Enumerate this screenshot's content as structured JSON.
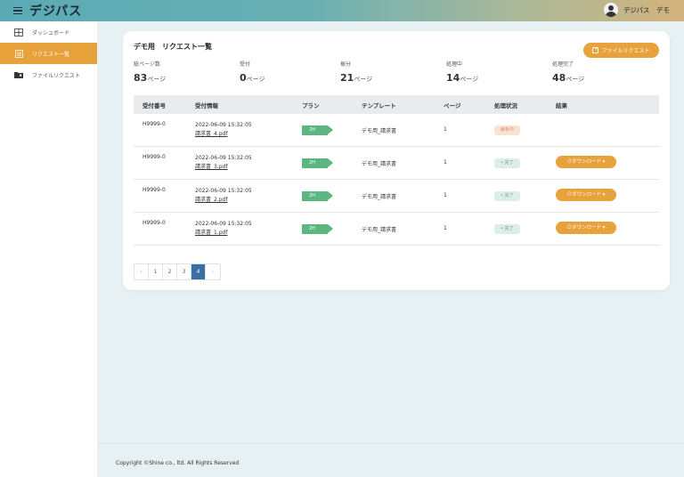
{
  "app": {
    "brand": "デジパス",
    "user": "デジパス　デモ"
  },
  "sidebar": {
    "items": [
      {
        "label": "ダッシュボード",
        "icon": "grid-icon"
      },
      {
        "label": "リクエスト一覧",
        "icon": "list-icon"
      },
      {
        "label": "ファイルリクエスト",
        "icon": "folder-icon"
      }
    ]
  },
  "card": {
    "title": "デモ用　リクエスト一覧",
    "file_request_button": "ファイルリクエスト"
  },
  "stats": [
    {
      "label": "総ページ数",
      "value": "83",
      "unit": "ページ"
    },
    {
      "label": "受付",
      "value": "0",
      "unit": "ページ"
    },
    {
      "label": "振分",
      "value": "21",
      "unit": "ページ"
    },
    {
      "label": "処理中",
      "value": "14",
      "unit": "ページ"
    },
    {
      "label": "処理完了",
      "value": "48",
      "unit": "ページ"
    }
  ],
  "table": {
    "headers": [
      "受付番号",
      "受付情報",
      "プラン",
      "テンプレート",
      "ページ",
      "処理状況",
      "結果"
    ],
    "rows": [
      {
        "id": "H9999-0",
        "date": "2022-06-09 15:32:05",
        "file": "請求書_4.pdf",
        "plan": "2H",
        "template": "デモ用_請求書",
        "pages": "1",
        "status": "解析中",
        "result": ""
      },
      {
        "id": "H9999-0",
        "date": "2022-06-09 15:32:05",
        "file": "請求書_3.pdf",
        "plan": "2H",
        "template": "デモ用_請求書",
        "pages": "1",
        "status": "完了",
        "result": "ダウンロード"
      },
      {
        "id": "H9999-0",
        "date": "2022-06-09 15:32:05",
        "file": "請求書_2.pdf",
        "plan": "2H",
        "template": "デモ用_請求書",
        "pages": "1",
        "status": "完了",
        "result": "ダウンロード"
      },
      {
        "id": "H9999-0",
        "date": "2022-06-09 15:32:05",
        "file": "請求書_1.pdf",
        "plan": "2H",
        "template": "デモ用_請求書",
        "pages": "1",
        "status": "完了",
        "result": "ダウンロード"
      }
    ]
  },
  "pagination": {
    "prev": "‹",
    "pages": [
      "1",
      "2",
      "3",
      "4"
    ],
    "current": "4",
    "next": "›"
  },
  "footer": {
    "copyright": "Copyright ©Shine co., ltd. All Rights Reserved"
  },
  "colors": {
    "accent": "#e8a23c",
    "plan": "#5cb680",
    "pager": "#3a6ea5",
    "background": "#e7f1f3"
  }
}
